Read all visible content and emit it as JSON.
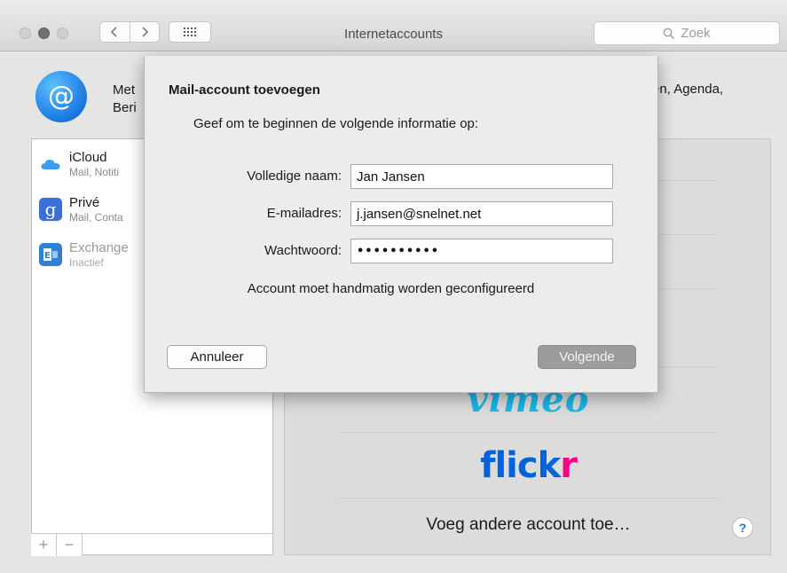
{
  "window": {
    "title": "Internetaccounts"
  },
  "toolbar": {
    "search_placeholder": "Zoek"
  },
  "intro": {
    "line1": "Met",
    "line2": "Beri",
    "line1_right": "en, Agenda,"
  },
  "accounts": [
    {
      "name": "iCloud",
      "subtitle": "Mail, Notiti",
      "icon": "icloud-icon"
    },
    {
      "name": "Privé",
      "subtitle": "Mail, Conta",
      "icon": "google-icon"
    },
    {
      "name": "Exchange",
      "subtitle": "Inactief",
      "icon": "exchange-icon"
    }
  ],
  "list_footer": {
    "add": "+",
    "remove": "−"
  },
  "providers": {
    "vimeo": "vimeo",
    "flickr_a": "flick",
    "flickr_b": "r",
    "other": "Voeg andere account toe…",
    "help": "?"
  },
  "dialog": {
    "title": "Mail-account toevoegen",
    "info": "Geef om te beginnen de volgende informatie op:",
    "name_label": "Volledige naam:",
    "name_value": "Jan Jansen",
    "email_label": "E-mailadres:",
    "email_value": "j.jansen@snelnet.net",
    "password_label": "Wachtwoord:",
    "password_value": "••••••••••",
    "note": "Account moet handmatig worden geconfigureerd",
    "cancel_label": "Annuleer",
    "next_label": "Volgende"
  }
}
